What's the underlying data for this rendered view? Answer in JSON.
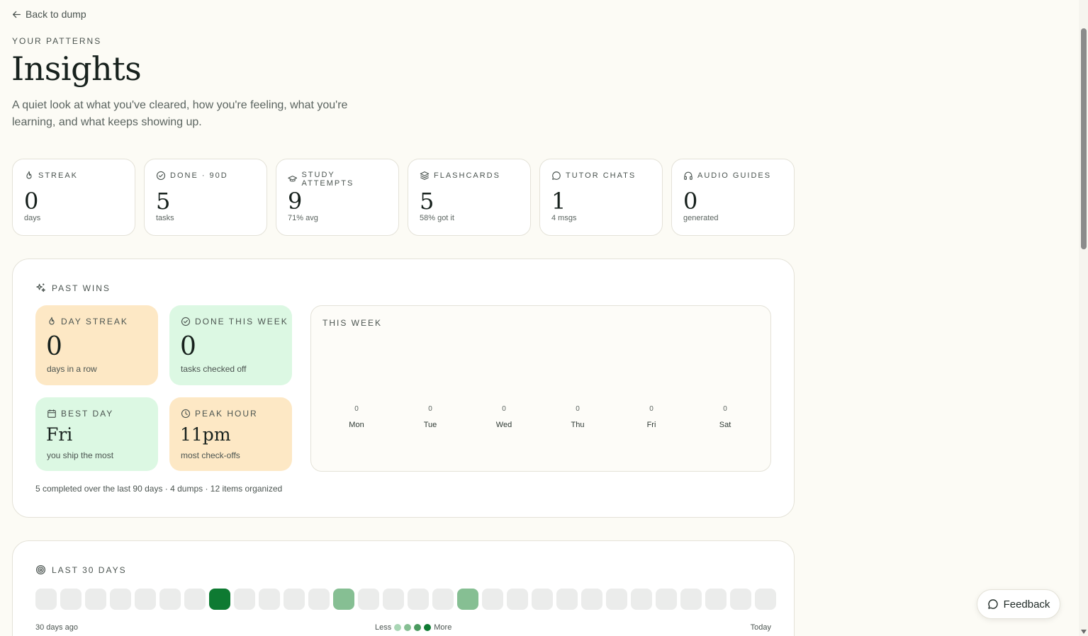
{
  "nav": {
    "back_label": "Back to dump"
  },
  "header": {
    "eyebrow": "YOUR PATTERNS",
    "title": "Insights",
    "subtitle": "A quiet look at what you've cleared, how you're feeling, what you're learning, and what keeps showing up."
  },
  "stats": [
    {
      "label": "STREAK",
      "value": "0",
      "sub": "days",
      "icon": "flame-icon"
    },
    {
      "label": "DONE · 90D",
      "value": "5",
      "sub": "tasks",
      "icon": "check-circle-icon"
    },
    {
      "label": "STUDY ATTEMPTS",
      "value": "9",
      "sub": "71% avg",
      "icon": "graduation-cap-icon"
    },
    {
      "label": "FLASHCARDS",
      "value": "5",
      "sub": "58% got it",
      "icon": "layers-icon"
    },
    {
      "label": "TUTOR CHATS",
      "value": "1",
      "sub": "4 msgs",
      "icon": "chat-bubble-icon"
    },
    {
      "label": "AUDIO GUIDES",
      "value": "0",
      "sub": "generated",
      "icon": "headphones-icon"
    }
  ],
  "past_wins": {
    "title": "PAST WINS",
    "tiles": [
      {
        "label": "DAY STREAK",
        "value": "0",
        "sub": "days in a row",
        "icon": "flame-icon",
        "color": "#fde8c5"
      },
      {
        "label": "DONE THIS WEEK",
        "value": "0",
        "sub": "tasks checked off",
        "icon": "check-circle-icon",
        "color": "#dcf8e3"
      },
      {
        "label": "BEST DAY",
        "value": "Fri",
        "sub": "you ship the most",
        "icon": "calendar-icon",
        "color": "#dcf8e3"
      },
      {
        "label": "PEAK HOUR",
        "value": "11pm",
        "sub": "most check-offs",
        "icon": "clock-icon",
        "color": "#fde8c5"
      }
    ],
    "this_week": {
      "title": "THIS WEEK",
      "days": [
        {
          "day": "Mon",
          "count": "0"
        },
        {
          "day": "Tue",
          "count": "0"
        },
        {
          "day": "Wed",
          "count": "0"
        },
        {
          "day": "Thu",
          "count": "0"
        },
        {
          "day": "Fri",
          "count": "0"
        },
        {
          "day": "Sat",
          "count": "0"
        }
      ]
    },
    "summary": "5 completed over the last 90 days · 4 dumps · 12 items organized"
  },
  "last_30": {
    "title": "LAST 30 DAYS",
    "levels": [
      0,
      0,
      0,
      0,
      0,
      0,
      0,
      4,
      0,
      0,
      0,
      0,
      2,
      0,
      0,
      0,
      0,
      2,
      0,
      0,
      0,
      0,
      0,
      0,
      0,
      0,
      0,
      0,
      0,
      0
    ],
    "start_label": "30 days ago",
    "end_label": "Today",
    "legend_less": "Less",
    "legend_more": "More"
  },
  "feedback": {
    "label": "Feedback"
  },
  "colors": {
    "background": "#fcfbf5",
    "accent_green": "#0e7a32",
    "amber": "#fde8c5",
    "mint": "#dcf8e3"
  }
}
